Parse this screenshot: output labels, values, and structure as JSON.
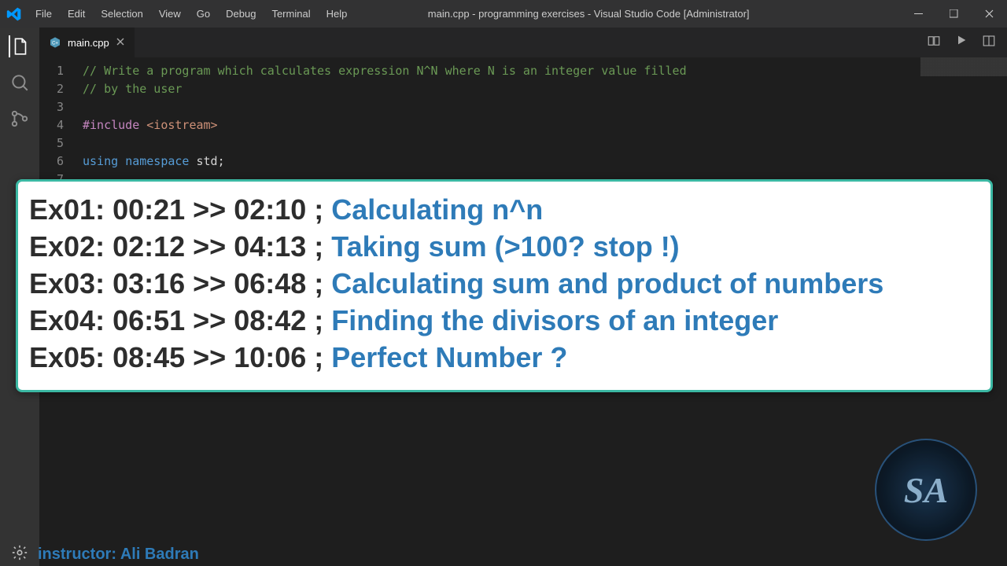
{
  "menus": [
    "File",
    "Edit",
    "Selection",
    "View",
    "Go",
    "Debug",
    "Terminal",
    "Help"
  ],
  "window_title": "main.cpp - programming exercises - Visual Studio Code [Administrator]",
  "tab": {
    "name": "main.cpp"
  },
  "code": {
    "l1": "// Write a program which calculates expression N^N where N is an integer value filled",
    "l2": "// by the user",
    "l4a": "#include",
    "l4b": " <iostream>",
    "l6a": "using ",
    "l6b": "namespace",
    "l6c": " std;"
  },
  "overlay": [
    {
      "pre": "Ex01: 00:21 >> 02:10 ; ",
      "topic": "Calculating n^n"
    },
    {
      "pre": "Ex02: 02:12 >> 04:13 ; ",
      "topic": "Taking sum (>100? stop !)"
    },
    {
      "pre": "Ex03: 03:16 >> 06:48 ; ",
      "topic": "Calculating sum and product of numbers"
    },
    {
      "pre": "Ex04: 06:51 >> 08:42 ; ",
      "topic": "Finding the divisors of an integer"
    },
    {
      "pre": "Ex05: 08:45 >> 10:06 ; ",
      "topic": "Perfect Number ?"
    }
  ],
  "instructor": "instructor: Ali Badran",
  "badge": "SA"
}
